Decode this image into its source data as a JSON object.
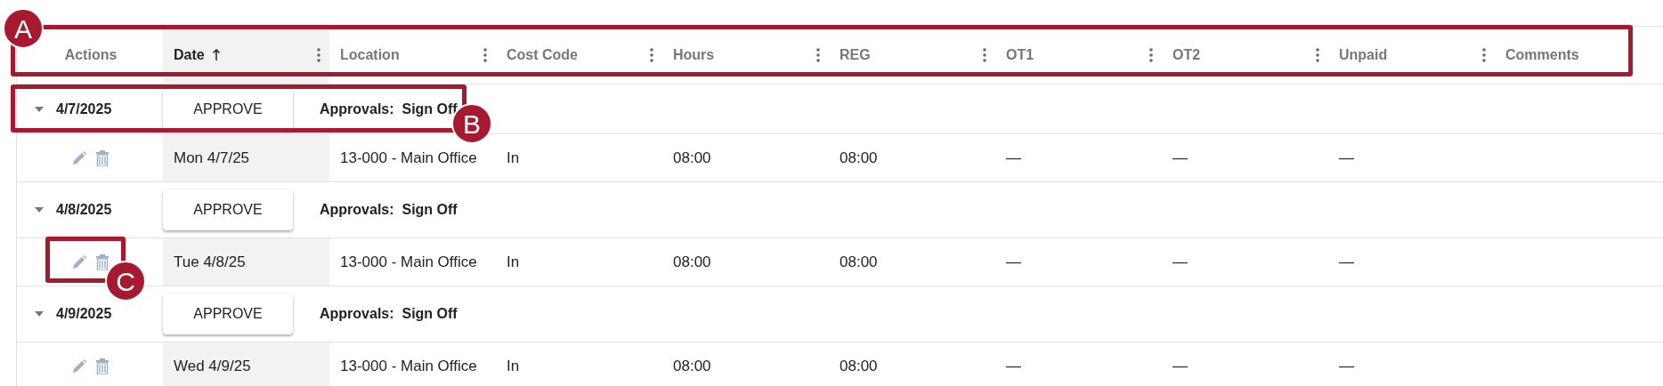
{
  "columns": [
    {
      "label": "Actions",
      "sorted": false,
      "menu": false
    },
    {
      "label": "Date",
      "sorted": true,
      "menu": true
    },
    {
      "label": "Location",
      "sorted": false,
      "menu": true
    },
    {
      "label": "Cost Code",
      "sorted": false,
      "menu": true
    },
    {
      "label": "Hours",
      "sorted": false,
      "menu": true
    },
    {
      "label": "REG",
      "sorted": false,
      "menu": true
    },
    {
      "label": "OT1",
      "sorted": false,
      "menu": true
    },
    {
      "label": "OT2",
      "sorted": false,
      "menu": true
    },
    {
      "label": "Unpaid",
      "sorted": false,
      "menu": true
    },
    {
      "label": "Comments",
      "sorted": false,
      "menu": false
    }
  ],
  "groups": [
    {
      "date": "4/7/2025",
      "expanded": true,
      "button": "APPROVE",
      "approvals": "Approvals:  Sign Off",
      "rows": [
        {
          "cells": [
            "Mon 4/7/25",
            "13-000 - Main Office",
            "In",
            "08:00",
            "08:00",
            "—",
            "—",
            "—"
          ]
        }
      ]
    },
    {
      "date": "4/8/2025",
      "expanded": true,
      "button": "APPROVE",
      "approvals": "Approvals:  Sign Off",
      "rows": [
        {
          "cells": [
            "Tue 4/8/25",
            "13-000 - Main Office",
            "In",
            "08:00",
            "08:00",
            "—",
            "—",
            "—"
          ]
        }
      ]
    },
    {
      "date": "4/9/2025",
      "expanded": true,
      "button": "APPROVE",
      "approvals": "Approvals:  Sign Off",
      "rows": [
        {
          "cells": [
            "Wed 4/9/25",
            "13-000 - Main Office",
            "In",
            "08:00",
            "08:00",
            "—",
            "—",
            "—"
          ]
        }
      ]
    }
  ],
  "callouts": [
    {
      "label": "A"
    },
    {
      "label": "B"
    },
    {
      "label": "C"
    }
  ]
}
